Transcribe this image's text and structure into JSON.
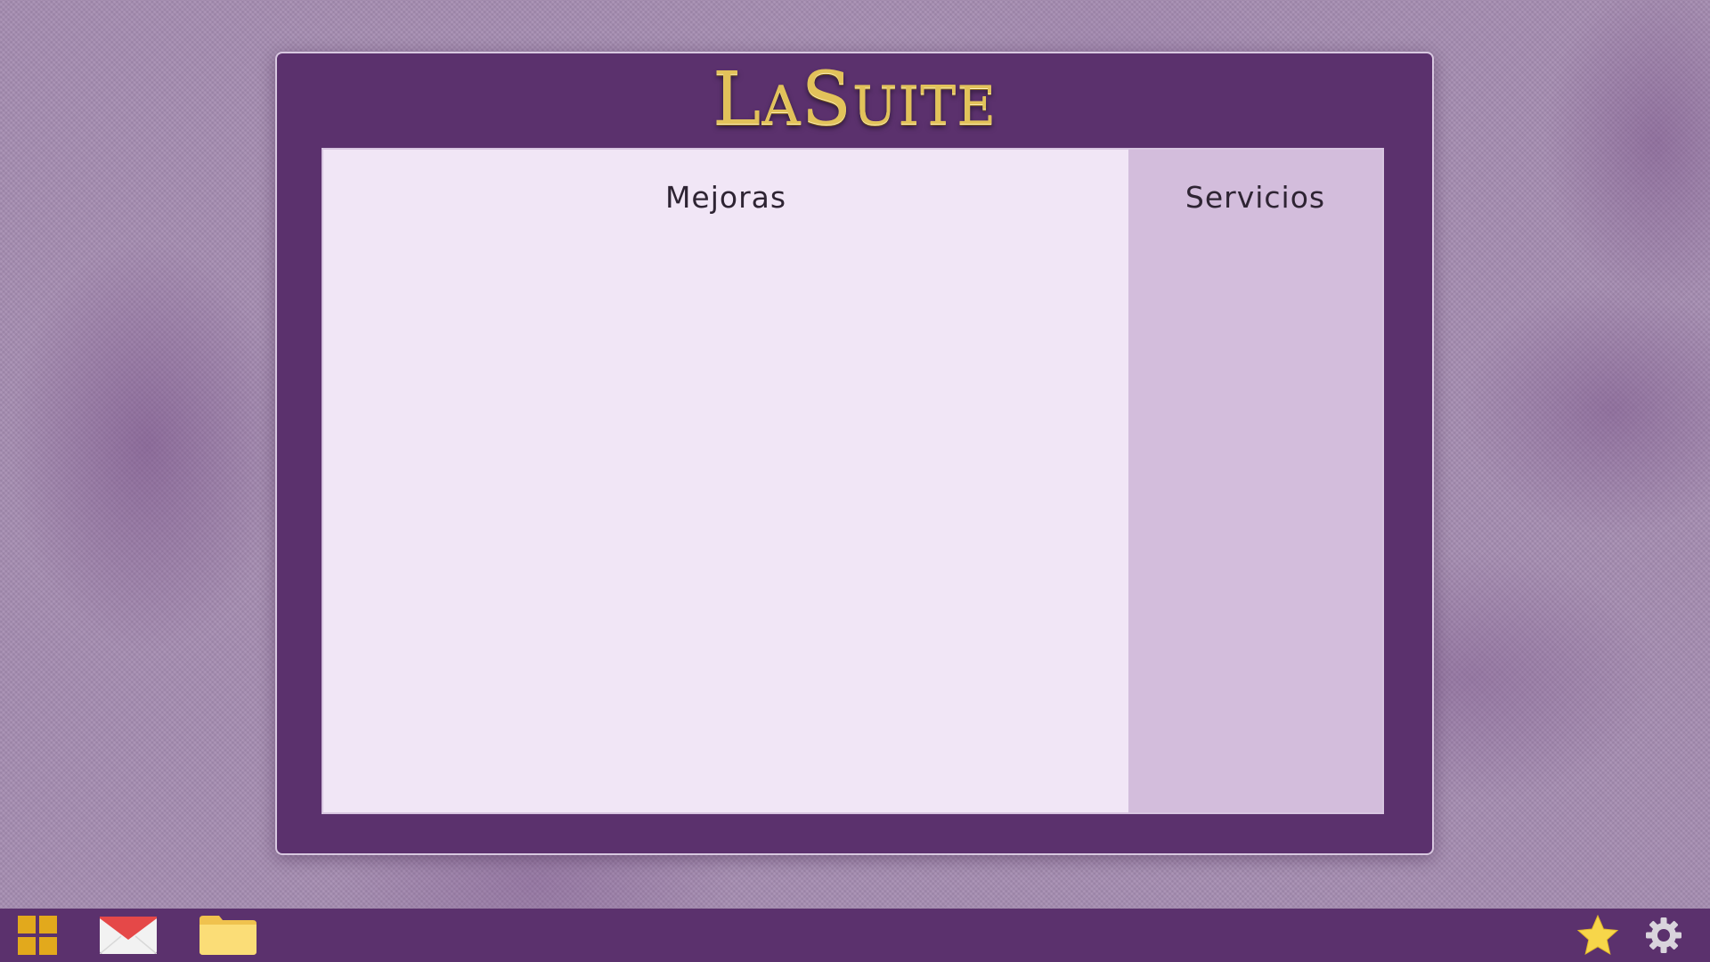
{
  "app": {
    "logo_text_first": "La",
    "logo_text_second": "Suite"
  },
  "panels": {
    "main_title": "Mejoras",
    "side_title": "Servicios"
  },
  "taskbar": {
    "left_items": [
      {
        "icon": "apps-grid-icon"
      },
      {
        "icon": "mail-icon"
      },
      {
        "icon": "folder-icon"
      }
    ],
    "right_items": [
      {
        "icon": "star-icon"
      },
      {
        "icon": "gear-icon"
      }
    ]
  },
  "colors": {
    "frame": "#5b316d",
    "main_pane": "#f1e6f6",
    "side_pane": "#d3bddc",
    "logo_gold": "#e2c25a",
    "accent_yellow": "#f5d34a"
  }
}
